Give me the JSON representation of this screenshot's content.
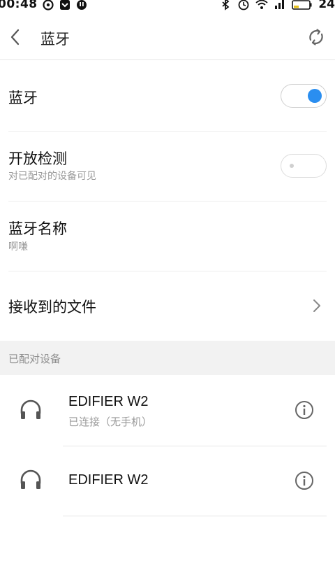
{
  "status_bar": {
    "time": "00:48",
    "battery": "24"
  },
  "nav": {
    "title": "蓝牙"
  },
  "settings": {
    "bluetooth": {
      "label": "蓝牙",
      "enabled": true
    },
    "discoverable": {
      "label": "开放检测",
      "subtitle": "对已配对的设备可见",
      "enabled": false
    },
    "device_name": {
      "label": "蓝牙名称",
      "value": "啊嗛"
    },
    "received_files": {
      "label": "接收到的文件"
    }
  },
  "paired_section": {
    "header": "已配对设备",
    "devices": [
      {
        "name": "EDIFIER W2",
        "status": "已连接（无手机）",
        "icon": "headphones-icon"
      },
      {
        "name": "EDIFIER W2",
        "status": "",
        "icon": "headphones-icon"
      }
    ]
  },
  "colors": {
    "accent": "#2a8ef0",
    "section_bg": "#f2f2f2"
  }
}
